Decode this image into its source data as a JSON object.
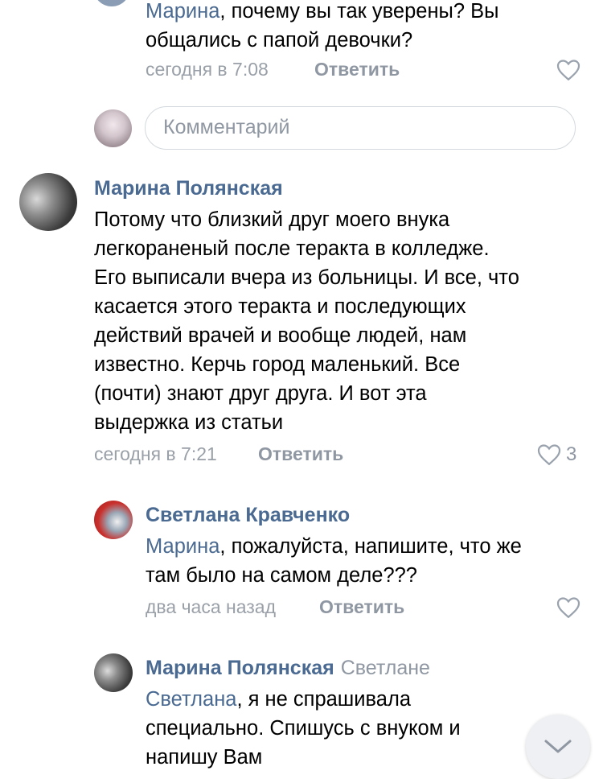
{
  "comments": [
    {
      "mention": "Марина",
      "text_rest_line1": ", почему вы так уверены? Вы",
      "text_line2": "общались с папой девочки?",
      "time": "сегодня в 7:08",
      "reply_label": "Ответить"
    },
    {
      "author": "Марина Полянская",
      "lines": [
        "Потому что близкий друг моего внука",
        "легкораненый после теракта в колледже.",
        "Его выписали вчера из больницы. И все, что",
        "касается этого теракта и последующих",
        "действий врачей и вообще людей, нам",
        "известно. Керчь город маленький. Все",
        "(почти) знают друг друга. И вот эта",
        "выдержка из статьи"
      ],
      "time": "сегодня в 7:21",
      "reply_label": "Ответить",
      "likes": "3"
    },
    {
      "author": "Светлана Кравченко",
      "mention": "Марина",
      "text_rest_line1": ", пожалуйста, напишите, что же",
      "text_line2": "там было на самом деле???",
      "time": "два часа назад",
      "reply_label": "Ответить"
    },
    {
      "author": "Марина Полянская",
      "reply_to": "Светлане",
      "mention": "Светлана",
      "text_rest_line1": ", я не спрашивала",
      "text_line2": "специально. Спишусь с внуком и",
      "text_line3": "напишу Вам"
    }
  ],
  "composer": {
    "placeholder": "Комментарий"
  },
  "colors": {
    "link": "#4a6a92",
    "meta": "#9aa0a8",
    "border": "#d3d9de"
  },
  "icons": {
    "like": "heart-outline-icon",
    "scroll": "chevron-down-icon"
  }
}
